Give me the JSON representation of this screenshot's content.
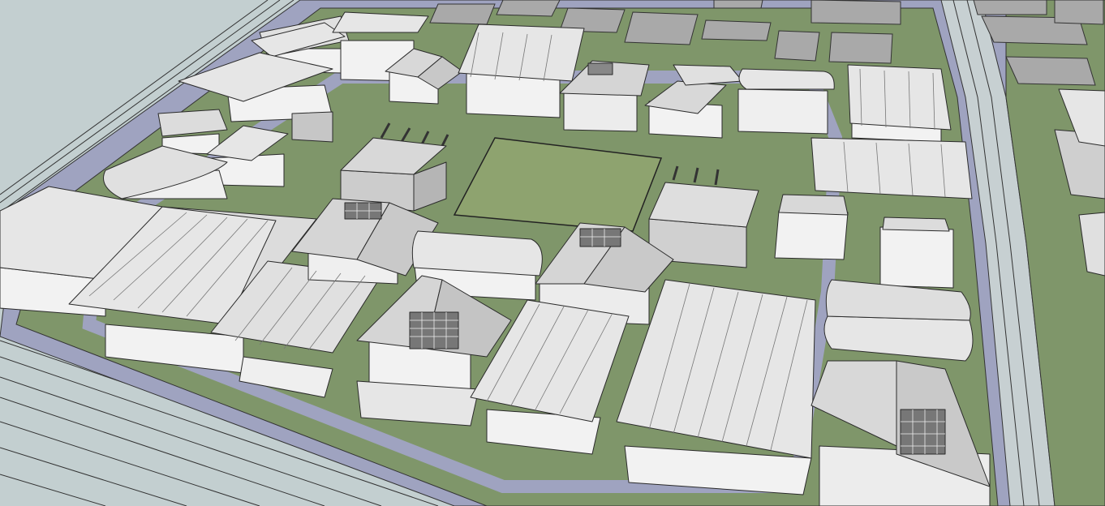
{
  "viewport": {
    "background": "#c3cfd0"
  },
  "scene": {
    "colors": {
      "ground": "#c3cfd0",
      "grass": "#7f966a",
      "plaza_grass": "#8ea36f",
      "road": "#9fa3c0",
      "pad": "#a9a9a9",
      "roof_light": "#e6e6e6",
      "roof_mid": "#d3d3d3",
      "wall": "#f2f2f2",
      "wall_shade": "#c6c6c6",
      "edge": "#2a2a2a"
    }
  }
}
